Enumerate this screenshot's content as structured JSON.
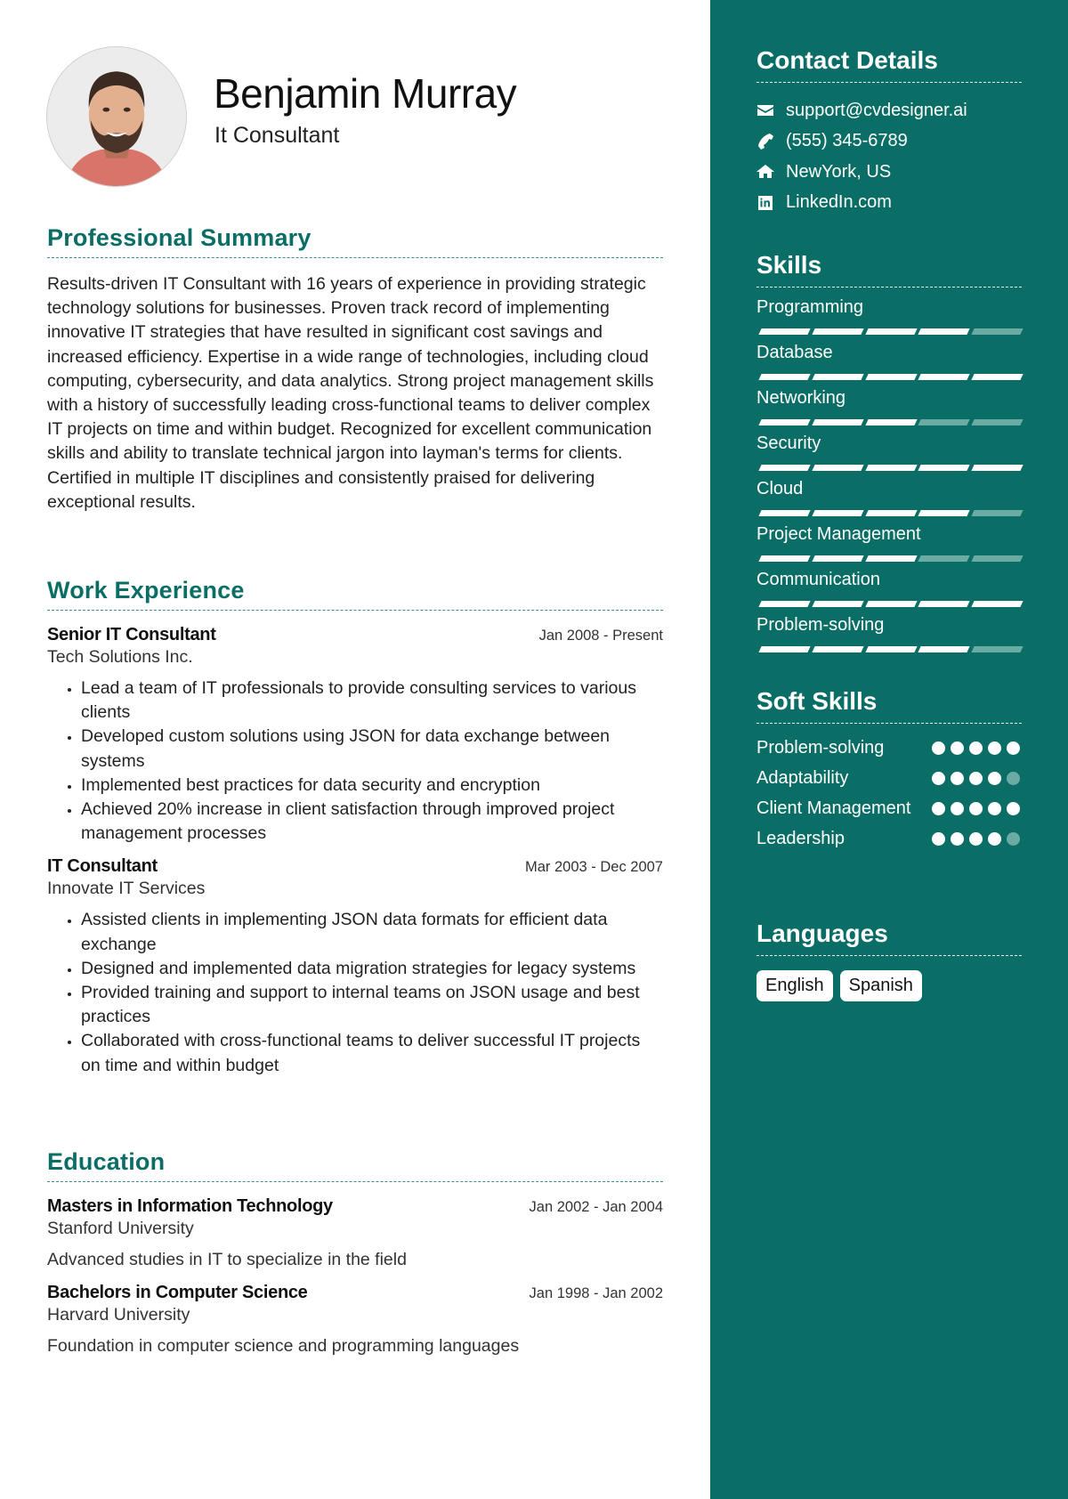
{
  "header": {
    "name": "Benjamin Murray",
    "title": "It Consultant",
    "photo": "profile-photo"
  },
  "summary": {
    "heading": "Professional Summary",
    "text": "Results-driven IT Consultant with 16 years of experience in providing strategic technology solutions for businesses. Proven track record of implementing innovative IT strategies that have resulted in significant cost savings and increased efficiency. Expertise in a wide range of technologies, including cloud computing, cybersecurity, and data analytics. Strong project management skills with a history of successfully leading cross-functional teams to deliver complex IT projects on time and within budget. Recognized for excellent communication skills and ability to translate technical jargon into layman's terms for clients. Certified in multiple IT disciplines and consistently praised for delivering exceptional results."
  },
  "experience": {
    "heading": "Work Experience",
    "jobs": [
      {
        "title": "Senior IT Consultant",
        "date": "Jan 2008 - Present",
        "company": "Tech Solutions Inc.",
        "bullets": [
          "Lead a team of IT professionals to provide consulting services to various clients",
          "Developed custom solutions using JSON for data exchange between systems",
          "Implemented best practices for data security and encryption",
          "Achieved 20% increase in client satisfaction through improved project management processes"
        ]
      },
      {
        "title": "IT Consultant",
        "date": "Mar 2003 - Dec 2007",
        "company": "Innovate IT Services",
        "bullets": [
          "Assisted clients in implementing JSON data formats for efficient data exchange",
          "Designed and implemented data migration strategies for legacy systems",
          "Provided training and support to internal teams on JSON usage and best practices",
          "Collaborated with cross-functional teams to deliver successful IT projects on time and within budget"
        ]
      }
    ]
  },
  "education": {
    "heading": "Education",
    "items": [
      {
        "degree": "Masters in Information Technology",
        "date": "Jan 2002 - Jan 2004",
        "school": "Stanford University",
        "description": "Advanced studies in IT to specialize in the field"
      },
      {
        "degree": "Bachelors in Computer Science",
        "date": "Jan 1998 - Jan 2002",
        "school": "Harvard University",
        "description": "Foundation in computer science and programming languages"
      }
    ]
  },
  "contact": {
    "heading": "Contact Details",
    "items": [
      {
        "icon": "envelope-icon",
        "text": "support@cvdesigner.ai"
      },
      {
        "icon": "phone-icon",
        "text": "(555) 345-6789"
      },
      {
        "icon": "home-icon",
        "text": "NewYork, US"
      },
      {
        "icon": "linkedin-icon",
        "text": "LinkedIn.com"
      }
    ]
  },
  "skills": {
    "heading": "Skills",
    "max": 5,
    "items": [
      {
        "name": "Programming",
        "level": 4
      },
      {
        "name": "Database",
        "level": 5
      },
      {
        "name": "Networking",
        "level": 3
      },
      {
        "name": "Security",
        "level": 5
      },
      {
        "name": "Cloud",
        "level": 4
      },
      {
        "name": "Project Management",
        "level": 3
      },
      {
        "name": "Communication",
        "level": 5
      },
      {
        "name": "Problem-solving",
        "level": 4
      }
    ]
  },
  "soft_skills": {
    "heading": "Soft Skills",
    "max": 5,
    "items": [
      {
        "name": "Problem-solving",
        "level": 5
      },
      {
        "name": "Adaptability",
        "level": 4
      },
      {
        "name": "Client Management",
        "level": 5
      },
      {
        "name": "Leadership",
        "level": 4
      }
    ]
  },
  "languages": {
    "heading": "Languages",
    "items": [
      "English",
      "Spanish"
    ]
  },
  "colors": {
    "accent": "#0b6e66",
    "inactive": "#6aaba4"
  }
}
